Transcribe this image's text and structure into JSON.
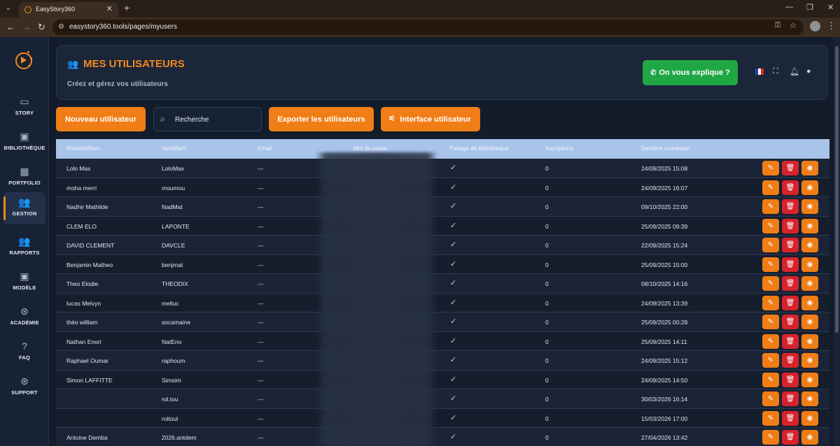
{
  "browser": {
    "tab_title": "EasyStory360",
    "url": "easystory360.tools/pages/myusers"
  },
  "sidebar": {
    "items": [
      {
        "label": "STORY",
        "icon": "laptop-icon"
      },
      {
        "label": "BIBLIOTHÈQUE",
        "icon": "images-icon"
      },
      {
        "label": "PORTFOLIO",
        "icon": "grid-icon"
      },
      {
        "label": "GESTION",
        "icon": "users-icon",
        "active": true
      },
      {
        "label": "RAPPORTS",
        "icon": "users-report-icon"
      },
      {
        "label": "MODÈLE",
        "icon": "photo-library-icon"
      },
      {
        "label": "ACADÉMIE",
        "icon": "academy-icon"
      },
      {
        "label": "FAQ",
        "icon": "help-circle-icon"
      },
      {
        "label": "SUPPORT",
        "icon": "support-icon"
      }
    ]
  },
  "header": {
    "title": "MES UTILISATEURS",
    "subtitle": "Créez et gérez vos utilisateurs",
    "help_button": "On vous explique ?"
  },
  "toolbar": {
    "new_user": "Nouveau utilisateur",
    "search_placeholder": "Recherche",
    "export": "Exporter les utilisateurs",
    "interface": "Interface utilisateur"
  },
  "table": {
    "columns": [
      "Prénom/Nom",
      "Identifiant",
      "Email",
      "Mot de passe",
      "Partage de bibliothèque",
      "Inscriptions",
      "Dernière connexion"
    ],
    "rows": [
      {
        "name": "Lolo Max",
        "id": "LoloMax",
        "email": "---",
        "inscriptions": "0",
        "last": "24/09/2025 15:08"
      },
      {
        "name": "moha merri",
        "id": "moumou",
        "email": "---",
        "inscriptions": "0",
        "last": "24/09/2025 16:07"
      },
      {
        "name": "Nadhir Mathilde",
        "id": "NadMat",
        "email": "---",
        "inscriptions": "0",
        "last": "09/10/2025 22:00"
      },
      {
        "name": "CLEM ELO",
        "id": "LAPONTE",
        "email": "---",
        "inscriptions": "0",
        "last": "25/09/2025 09:39"
      },
      {
        "name": "DAVID CLEMENT",
        "id": "DAVCLE",
        "email": "---",
        "inscriptions": "0",
        "last": "22/09/2025 15:24"
      },
      {
        "name": "Benjamin Matheo",
        "id": "benjmat",
        "email": "---",
        "inscriptions": "0",
        "last": "25/09/2025 15:00"
      },
      {
        "name": "Theo Elodie",
        "id": "THEODIX",
        "email": "---",
        "inscriptions": "0",
        "last": "08/10/2025 14:16"
      },
      {
        "name": "lucas Melvyn",
        "id": "melluc",
        "email": "---",
        "inscriptions": "0",
        "last": "24/09/2025 13:39"
      },
      {
        "name": "théo william",
        "id": "socamaine",
        "email": "---",
        "inscriptions": "0",
        "last": "25/09/2025 00:28"
      },
      {
        "name": "Nathan Enori",
        "id": "NatEno",
        "email": "---",
        "inscriptions": "0",
        "last": "25/09/2025 14:11"
      },
      {
        "name": "Raphael Oumar",
        "id": "raphoum",
        "email": "---",
        "inscriptions": "0",
        "last": "24/09/2025 15:12"
      },
      {
        "name": "Simon LAFFITTE",
        "id": "Simsim",
        "email": "---",
        "inscriptions": "0",
        "last": "24/09/2025 14:50"
      },
      {
        "name": "",
        "id": "rol.tou",
        "email": "---",
        "inscriptions": "0",
        "last": "30/03/2026 16:14"
      },
      {
        "name": "",
        "id": "roltoul",
        "email": "---",
        "inscriptions": "0",
        "last": "15/03/2026 17:00"
      },
      {
        "name": "Antoine Demba",
        "id": "2026.antdem",
        "email": "---",
        "inscriptions": "0",
        "last": "27/04/2026 13:42"
      }
    ]
  },
  "colors": {
    "accent": "#f07d16",
    "danger": "#d7232b",
    "success": "#1fa744",
    "header_row": "#a9c4ea"
  }
}
